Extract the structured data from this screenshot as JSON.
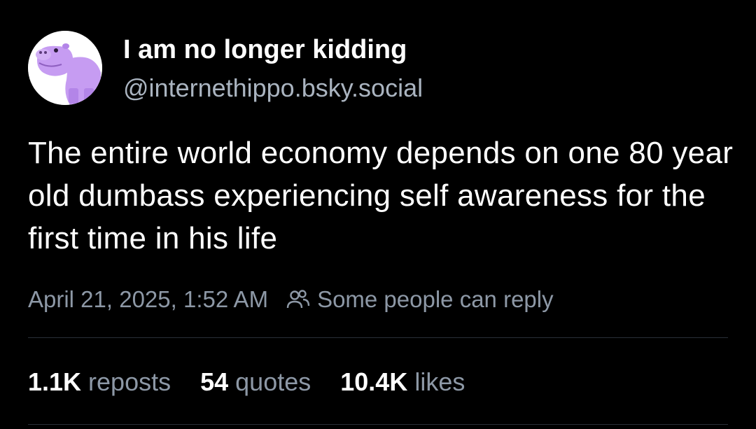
{
  "author": {
    "display_name": "I am no longer kidding",
    "handle": "@internethippo.bsky.social",
    "avatar_icon": "purple-hippo-avatar"
  },
  "post": {
    "text": "The entire world economy depends on one 80 year old dumbass experiencing self awareness for the first time in his life",
    "timestamp": "April 21, 2025, 1:52 AM",
    "reply_setting": "Some people can reply",
    "reply_icon": "people-icon"
  },
  "stats": {
    "reposts_count": "1.1K",
    "reposts_label": "reposts",
    "quotes_count": "54",
    "quotes_label": "quotes",
    "likes_count": "10.4K",
    "likes_label": "likes"
  },
  "colors": {
    "background": "#000000",
    "text_primary": "#ffffff",
    "text_secondary": "#8d98a6",
    "avatar_hippo": "#c69cf2"
  }
}
